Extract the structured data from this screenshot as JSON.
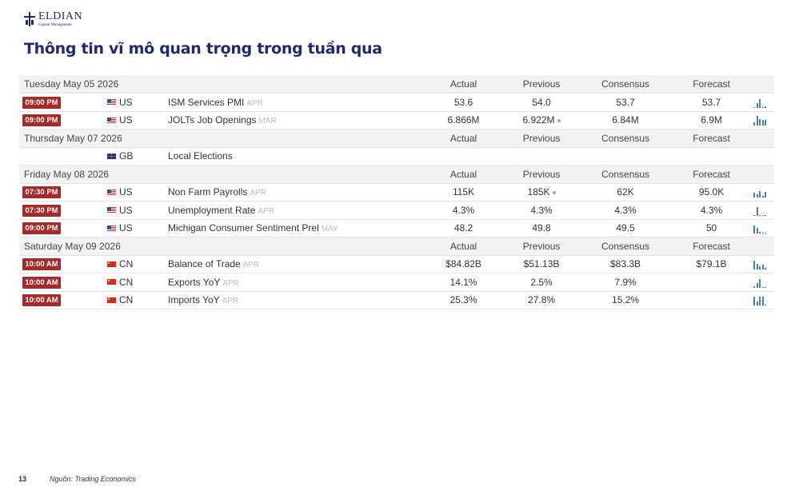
{
  "brand": {
    "name": "ELDIAN",
    "subtitle": "Capital Management"
  },
  "page_title": "Thông tin vĩ mô quan trọng trong tuần qua",
  "calendar": [
    {
      "date": "Tuesday May 05 2026",
      "headers": [
        "Actual",
        "Previous",
        "Consensus",
        "Forecast"
      ],
      "events": [
        {
          "time": "09:00 PM",
          "country": "US",
          "event": "ISM Services PMI",
          "ref": "APR",
          "actual": "53.6",
          "previous": "54.0",
          "revised": false,
          "consensus": "53.7",
          "forecast": "53.7",
          "spark": [
            0.1,
            0.5,
            0.9,
            0.1,
            0.2
          ]
        },
        {
          "time": "09:00 PM",
          "country": "US",
          "event": "JOLTs Job Openings",
          "ref": "MAR",
          "actual": "6.866M",
          "previous": "6.922M",
          "revised": true,
          "consensus": "6.84M",
          "forecast": "6.9M",
          "spark": [
            0.3,
            1.0,
            0.7,
            0.6,
            0.6
          ]
        }
      ]
    },
    {
      "date": "Thursday May 07 2026",
      "headers": [
        "Actual",
        "Previous",
        "Consensus",
        "Forecast"
      ],
      "events": [
        {
          "time": "",
          "country": "GB",
          "event": "Local Elections",
          "ref": "",
          "actual": "",
          "previous": "",
          "revised": false,
          "consensus": "",
          "forecast": "",
          "spark": []
        }
      ]
    },
    {
      "date": "Friday May 08 2026",
      "headers": [
        "Actual",
        "Previous",
        "Consensus",
        "Forecast"
      ],
      "events": [
        {
          "time": "07:30 PM",
          "country": "US",
          "event": "Non Farm Payrolls",
          "ref": "APR",
          "actual": "115K",
          "previous": "185K",
          "revised": true,
          "consensus": "62K",
          "forecast": "95.0K",
          "spark": [
            0.5,
            0.3,
            0.7,
            0.2,
            0.6
          ]
        },
        {
          "time": "07:30 PM",
          "country": "US",
          "event": "Unemployment Rate",
          "ref": "APR",
          "actual": "4.3%",
          "previous": "4.3%",
          "revised": false,
          "consensus": "4.3%",
          "forecast": "4.3%",
          "spark": [
            0.1,
            0.9,
            0.1,
            0.1,
            0.1
          ]
        },
        {
          "time": "09:00 PM",
          "country": "US",
          "event": "Michigan Consumer Sentiment Prel",
          "ref": "MAY",
          "actual": "48.2",
          "previous": "49.8",
          "revised": false,
          "consensus": "49.5",
          "forecast": "50",
          "spark": [
            0.8,
            0.6,
            0.2,
            0.1,
            0.1
          ]
        }
      ]
    },
    {
      "date": "Saturday May 09 2026",
      "headers": [
        "Actual",
        "Previous",
        "Consensus",
        "Forecast"
      ],
      "events": [
        {
          "time": "10:00 AM",
          "country": "CN",
          "event": "Balance of Trade",
          "ref": "APR",
          "actual": "$84.82B",
          "previous": "$51.13B",
          "revised": false,
          "consensus": "$83.3B",
          "forecast": "$79.1B",
          "spark": [
            0.9,
            0.6,
            0.3,
            0.5,
            0.2
          ]
        },
        {
          "time": "10:00 AM",
          "country": "CN",
          "event": "Exports YoY",
          "ref": "APR",
          "actual": "14.1%",
          "previous": "2.5%",
          "revised": false,
          "consensus": "7.9%",
          "forecast": "",
          "spark": [
            0.2,
            0.5,
            0.9,
            0.1,
            0.1
          ]
        },
        {
          "time": "10:00 AM",
          "country": "CN",
          "event": "Imports YoY",
          "ref": "APR",
          "actual": "25.3%",
          "previous": "27.8%",
          "revised": false,
          "consensus": "15.2%",
          "forecast": "",
          "spark": [
            0.9,
            0.4,
            0.9,
            0.9,
            0.1
          ]
        }
      ]
    }
  ],
  "footer": {
    "page_number": "13",
    "source": "Nguồn: Trading Economics"
  },
  "colors": {
    "brand": "#1e2a6e",
    "badge": "#a52a2a",
    "previous": "#2e8b2e",
    "spark": "#4a7fc1"
  }
}
